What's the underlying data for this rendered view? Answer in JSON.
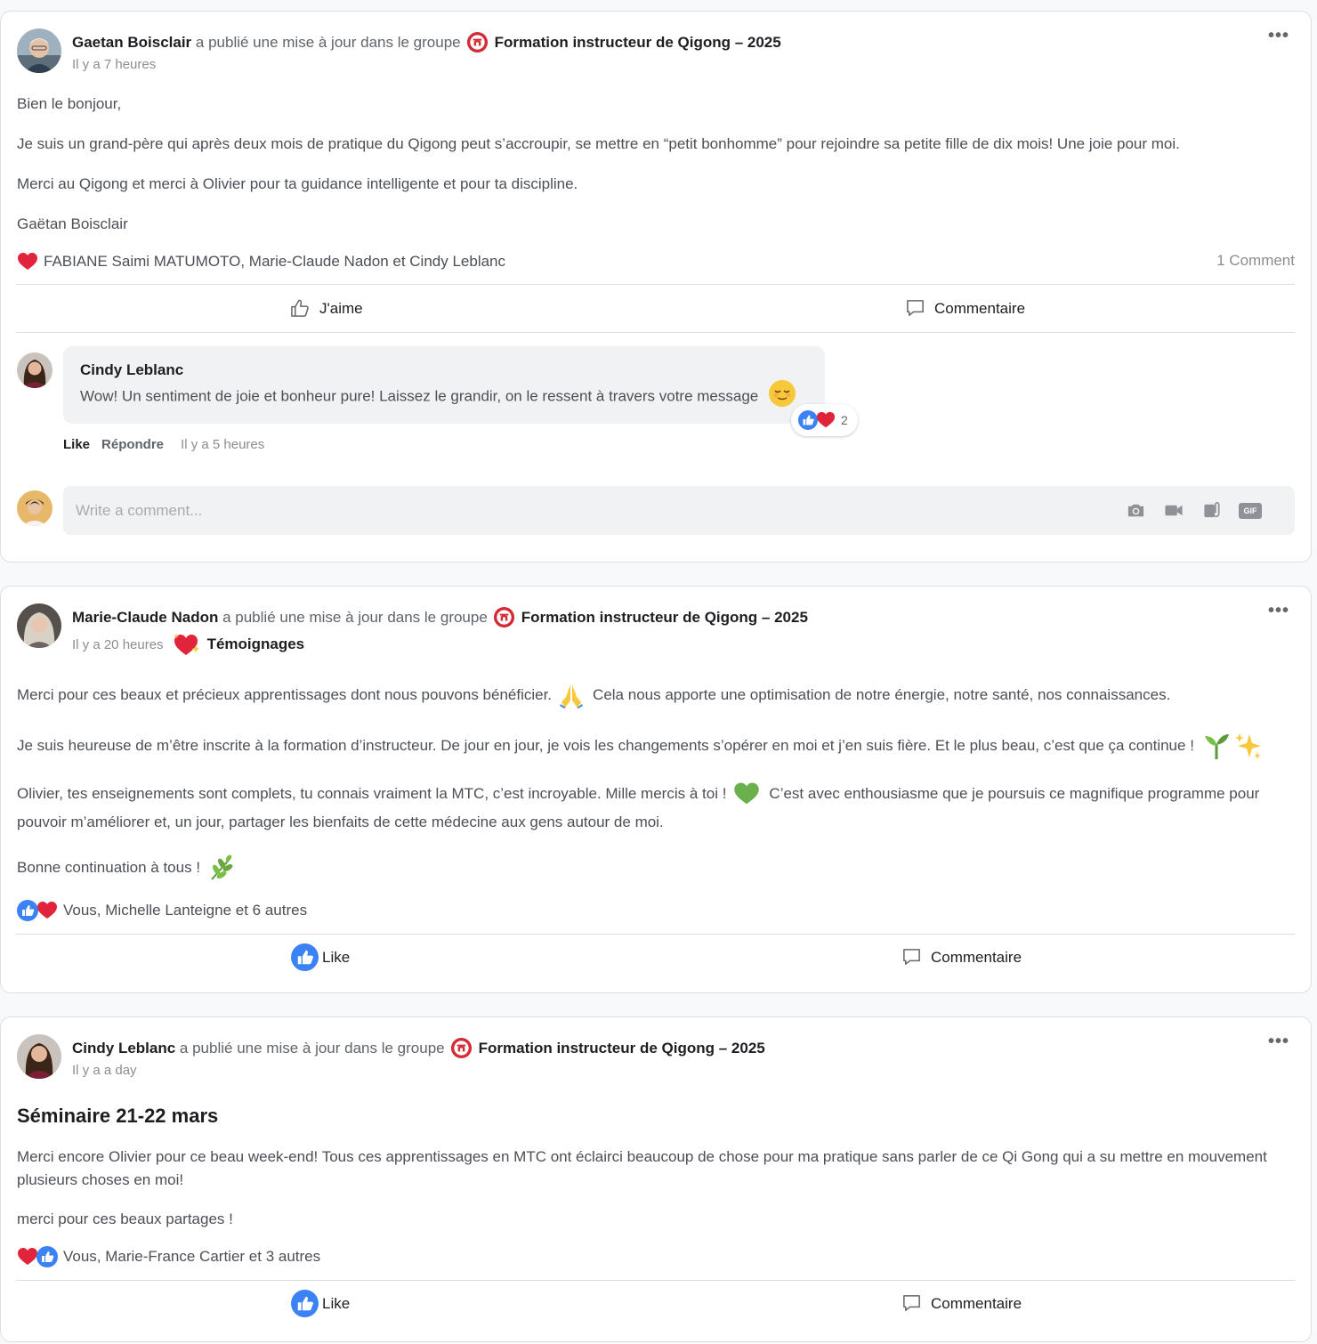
{
  "colors": {
    "accent": "#3b82f6",
    "heart": "#e0243b",
    "logo": "#d42a35",
    "text": "#1c1e21",
    "muted": "#8a8d91"
  },
  "posts": [
    {
      "author": "Gaetan Boisclair",
      "action": "a publié une mise à jour dans le groupe",
      "group": "Formation instructeur de Qigong – 2025",
      "time": "Il y a 7 heures",
      "paragraphs": [
        "Bien le bonjour,",
        "Je suis un grand-père qui après deux mois de pratique du Qigong peut s’accroupir, se mettre en “petit bonhomme” pour rejoindre sa petite fille de dix mois! Une joie pour moi.",
        "Merci au Qigong et merci à Olivier pour ta guidance intelligente et pour ta discipline.",
        "Gaëtan Boisclair"
      ],
      "reactions_text": "FABIANE Saimi MATUMOTO, Marie-Claude Nadon et Cindy Leblanc",
      "comment_count": "1 Comment",
      "like_label": "J'aime",
      "comment_label": "Commentaire",
      "comment": {
        "author": "Cindy Leblanc",
        "text": "Wow! Un sentiment de joie et bonheur pure! Laissez le grandir, on le ressent à travers votre message",
        "reaction_count": "2",
        "like": "Like",
        "reply": "Répondre",
        "time": "Il y a 5 heures"
      },
      "write_placeholder": "Write a comment...",
      "write_icons": [
        "camera-icon",
        "video-icon",
        "attachment-icon",
        "gif-icon"
      ],
      "gif_label": "GIF"
    },
    {
      "author": "Marie-Claude Nadon",
      "action": "a publié une mise à jour dans le groupe",
      "group": "Formation instructeur de Qigong – 2025",
      "time": "Il y a 20 heures",
      "tag": "Témoignages",
      "p1a": "Merci pour ces beaux et précieux apprentissages dont nous pouvons bénéficier.",
      "p1b": "Cela nous apporte une optimisation de notre énergie, notre santé, nos connaissances.",
      "p2": "Je suis heureuse de m’être inscrite à la formation d’instructeur. De jour en jour, je vois les changements s’opérer en moi et j’en suis fière. Et le plus beau, c’est que ça continue !",
      "p3a": "Olivier, tes enseignements sont complets, tu connais vraiment la MTC, c’est incroyable. Mille mercis à toi !",
      "p3b": "C’est avec enthousiasme que je poursuis ce magnifique programme pour",
      "p3c": "pouvoir m’améliorer et, un jour, partager les bienfaits de cette médecine aux gens autour de moi.",
      "p4": "Bonne continuation à tous !",
      "reactions_text": "Vous, Michelle Lanteigne et 6 autres",
      "like_label": "Like",
      "comment_label": "Commentaire"
    },
    {
      "author": "Cindy Leblanc",
      "action": "a publié une mise à jour dans le groupe",
      "group": "Formation instructeur de Qigong – 2025",
      "time": "Il y a a day",
      "title": "Séminaire 21-22 mars",
      "p1": "Merci encore Olivier pour ce beau week-end! Tous ces apprentissages en MTC ont éclairci beaucoup de chose pour ma pratique sans parler de ce Qi Gong qui a su mettre en mouvement plusieurs choses en moi!",
      "p2": "merci pour ces beaux partages !",
      "reactions_text": "Vous, Marie-France Cartier et 3 autres",
      "like_label": "Like",
      "comment_label": "Commentaire"
    }
  ]
}
